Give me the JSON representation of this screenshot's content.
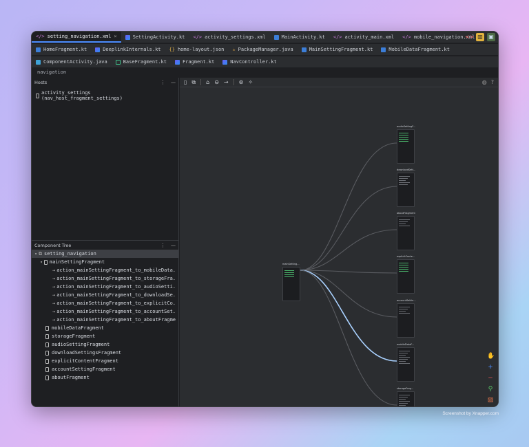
{
  "tabs_row1": [
    {
      "icon": "xml",
      "label": "setting_navigation.xml",
      "active": true
    },
    {
      "icon": "kt",
      "label": "SettingActivity.kt"
    },
    {
      "icon": "xml",
      "label": "activity_settings.xml"
    },
    {
      "icon": "blue",
      "label": "MainActivity.kt"
    },
    {
      "icon": "xml",
      "label": "activity_main.xml"
    },
    {
      "icon": "xml",
      "label": "mobile_navigation.xml"
    }
  ],
  "tabs_row2": [
    {
      "icon": "blue",
      "label": "HomeFragment.kt"
    },
    {
      "icon": "kt",
      "label": "DeeplinkInternals.kt"
    },
    {
      "icon": "json",
      "label": "home-layout.json"
    },
    {
      "icon": "java",
      "label": "PackageManager.java"
    },
    {
      "icon": "blue",
      "label": "MainSettingFragment.kt"
    },
    {
      "icon": "blue",
      "label": "MobileDataFragment.kt"
    }
  ],
  "tabs_row3": [
    {
      "icon": "comp",
      "label": "ComponentActivity.java"
    },
    {
      "icon": "base",
      "label": "BaseFragment.kt"
    },
    {
      "icon": "kt",
      "label": "Fragment.kt"
    },
    {
      "icon": "kt",
      "label": "NavController.kt"
    }
  ],
  "breadcrumb": "navigation",
  "hosts": {
    "title": "Hosts",
    "items": [
      "activity_settings (nav_host_fragment_settings)"
    ]
  },
  "component_tree": {
    "title": "Component Tree",
    "root": "setting_navigation",
    "parent": "mainSettingFragment",
    "actions": [
      "action_mainSettingFragment_to_mobileData.",
      "action_mainSettingFragment_to_storageFra.",
      "action_mainSettingFragment_to_audioSetti.",
      "action_mainSettingFragment_to_downloadSe.",
      "action_mainSettingFragment_to_explicitCo.",
      "action_mainSettingFragment_to_accountSet.",
      "action_mainSettingFragment_to_aboutFragme"
    ],
    "fragments": [
      "mobileDataFragment",
      "storageFragment",
      "audioSettingFragment",
      "downloadSettingsFragment",
      "explicitContentFragment",
      "accountSettingFragment",
      "aboutFragment"
    ]
  },
  "graph": {
    "source_label": "mainSetting...",
    "destinations": [
      "audioSettingF...",
      "downloadSett...",
      "aboutFragment",
      "explicitConte...",
      "accountSettin...",
      "mobileDataF...",
      "storageFrag..."
    ]
  },
  "colors": {
    "accent": "#4c8dff",
    "highlight_edge": "#a9d1ff",
    "edge": "#5a5c61"
  },
  "credit": "Screenshot by Xnapper.com"
}
